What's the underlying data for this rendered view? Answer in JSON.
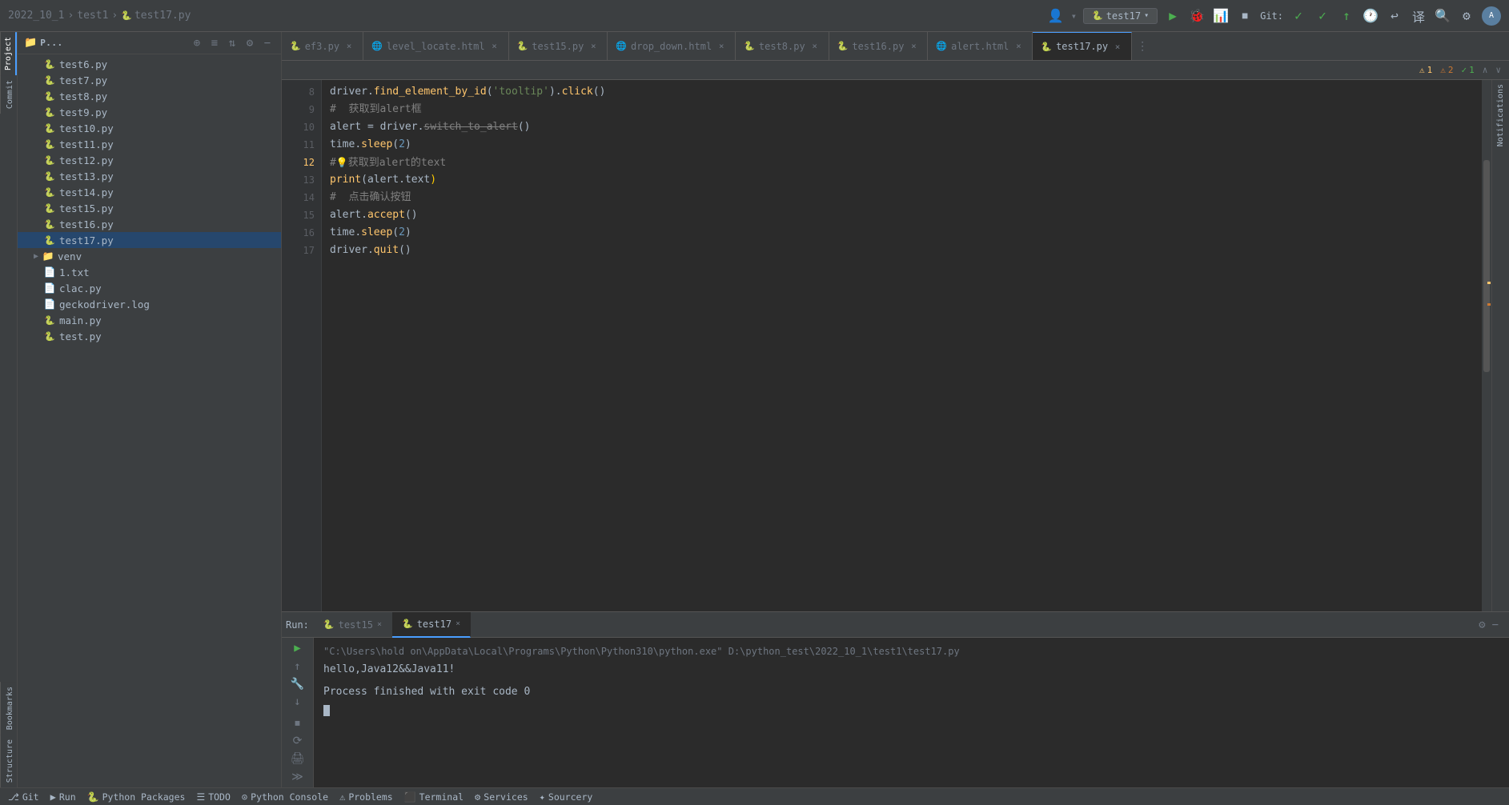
{
  "titlebar": {
    "breadcrumb": [
      "2022_10_1",
      "test1",
      "test17.py"
    ],
    "run_config": "test17",
    "git_label": "Git:"
  },
  "tabs": [
    {
      "label": "ef3.py",
      "type": "py",
      "closable": true
    },
    {
      "label": "level_locate.html",
      "type": "html",
      "closable": true
    },
    {
      "label": "test15.py",
      "type": "py",
      "closable": true
    },
    {
      "label": "drop_down.html",
      "type": "html",
      "closable": true
    },
    {
      "label": "test8.py",
      "type": "py",
      "closable": true
    },
    {
      "label": "test16.py",
      "type": "py",
      "closable": true
    },
    {
      "label": "alert.html",
      "type": "html",
      "closable": true
    },
    {
      "label": "test17.py",
      "type": "py",
      "closable": true,
      "active": true
    }
  ],
  "warnings": {
    "warn_count": "1",
    "err_count": "2",
    "ok_count": "1"
  },
  "file_tree": {
    "items": [
      {
        "name": "test6.py",
        "type": "py",
        "indent": 1
      },
      {
        "name": "test7.py",
        "type": "py",
        "indent": 1
      },
      {
        "name": "test8.py",
        "type": "py",
        "indent": 1
      },
      {
        "name": "test9.py",
        "type": "py",
        "indent": 1
      },
      {
        "name": "test10.py",
        "type": "py",
        "indent": 1
      },
      {
        "name": "test11.py",
        "type": "py",
        "indent": 1
      },
      {
        "name": "test12.py",
        "type": "py",
        "indent": 1
      },
      {
        "name": "test13.py",
        "type": "py",
        "indent": 1
      },
      {
        "name": "test14.py",
        "type": "py",
        "indent": 1
      },
      {
        "name": "test15.py",
        "type": "py",
        "indent": 1
      },
      {
        "name": "test16.py",
        "type": "py",
        "indent": 1
      },
      {
        "name": "test17.py",
        "type": "py",
        "indent": 1,
        "selected": true
      },
      {
        "name": "venv",
        "type": "folder",
        "indent": 1,
        "collapsed": true
      },
      {
        "name": "1.txt",
        "type": "txt",
        "indent": 1
      },
      {
        "name": "clac.py",
        "type": "py",
        "indent": 1
      },
      {
        "name": "geckodriver.log",
        "type": "log",
        "indent": 1
      },
      {
        "name": "main.py",
        "type": "py",
        "indent": 1
      },
      {
        "name": "test.py",
        "type": "py",
        "indent": 1
      }
    ]
  },
  "code_lines": [
    {
      "num": "8",
      "content": "driver.find_element_by_id('tooltip').click()"
    },
    {
      "num": "9",
      "content": "#  获取到alert框"
    },
    {
      "num": "10",
      "content": "alert = driver.switch_to_alert()"
    },
    {
      "num": "11",
      "content": "time.sleep(2)"
    },
    {
      "num": "12",
      "content": "#●获取到alert的text"
    },
    {
      "num": "13",
      "content": "print(alert.text)"
    },
    {
      "num": "14",
      "content": "#  点击确认按钮"
    },
    {
      "num": "15",
      "content": "alert.accept()"
    },
    {
      "num": "16",
      "content": "time.sleep(2)"
    },
    {
      "num": "17",
      "content": "driver.quit()"
    }
  ],
  "run_panel": {
    "tabs": [
      {
        "label": "test15",
        "active": false,
        "closable": true
      },
      {
        "label": "test17",
        "active": true,
        "closable": true
      }
    ],
    "run_label": "Run:",
    "command": "\"C:\\Users\\hold on\\AppData\\Local\\Programs\\Python\\Python310\\python.exe\" D:\\python_test\\2022_10_1\\test1\\test17.py",
    "output1": "hello,Java12&&Java11!",
    "output2": "",
    "output3": "Process finished with exit code 0"
  },
  "status_bar": {
    "git_label": "Git",
    "run_label": "Run",
    "python_packages_label": "Python Packages",
    "todo_label": "TODO",
    "python_console_label": "Python Console",
    "problems_label": "Problems",
    "terminal_label": "Terminal",
    "services_label": "Services",
    "sourcery_label": "Sourcery"
  },
  "activity_bar": {
    "items": [
      {
        "label": "Project",
        "active": true
      },
      {
        "label": "Commit"
      },
      {
        "label": ""
      },
      {
        "label": "Bookmarks"
      },
      {
        "label": "Structure"
      }
    ]
  }
}
